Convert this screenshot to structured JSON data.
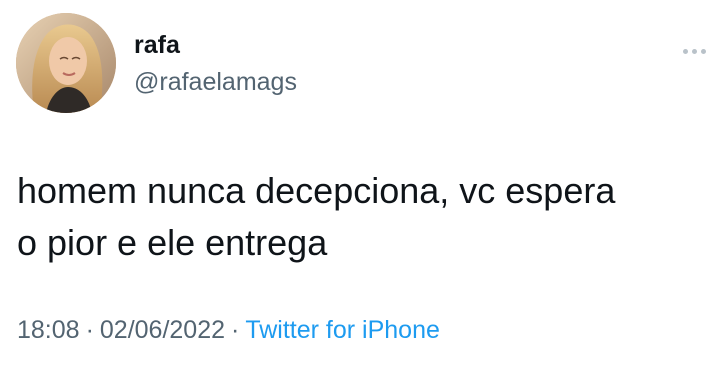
{
  "user": {
    "display_name": "rafa",
    "handle": "@rafaelamags",
    "avatar_icon": "profile-photo"
  },
  "more_icon": "ellipsis-icon",
  "tweet": {
    "text_line1": "homem nunca decepciona, vc espera",
    "text_line2": "o pior e ele entrega"
  },
  "meta": {
    "time": "18:08",
    "separator": "·",
    "date": "02/06/2022",
    "source": "Twitter for iPhone"
  },
  "colors": {
    "text": "#0f1419",
    "secondary": "#536471",
    "link": "#1d9bf0"
  }
}
